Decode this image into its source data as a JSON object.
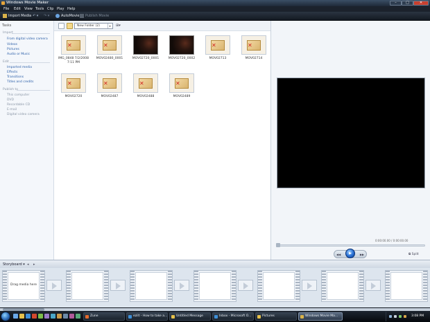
{
  "window": {
    "title": "Windows Movie Maker"
  },
  "menu": [
    "File",
    "Edit",
    "View",
    "Tools",
    "Clip",
    "Play",
    "Help"
  ],
  "toolbar": {
    "import_media": "Import Media",
    "automovie": "AutoMovie",
    "publish_movie": "Publish Movie"
  },
  "tasks": {
    "title": "Tasks",
    "import": {
      "header": "Import",
      "items": [
        "From digital video camera",
        "Videos",
        "Pictures",
        "Audio or Music"
      ]
    },
    "edit": {
      "header": "Edit",
      "items": [
        "Imported media",
        "Effects",
        "Transitions",
        "Titles and credits"
      ]
    },
    "publish": {
      "header": "Publish to",
      "items": [
        "This computer",
        "DVD",
        "Recordable CD",
        "E-mail",
        "Digital video camera"
      ]
    }
  },
  "collection": {
    "folder": "New Folder (2)",
    "items": [
      {
        "caption": "IMG_0848 7/2/2008 7:11 PM",
        "kind": "missing"
      },
      {
        "caption": "MOV02480_0001",
        "kind": "missing"
      },
      {
        "caption": "MOV02720_0001",
        "kind": "dark"
      },
      {
        "caption": "MOV02720_0002",
        "kind": "dark"
      },
      {
        "caption": "MOV02713",
        "kind": "missing"
      },
      {
        "caption": "MOV02714",
        "kind": "missing"
      },
      {
        "caption": "MOV02720",
        "kind": "missing"
      },
      {
        "caption": "MOV02487",
        "kind": "missing"
      },
      {
        "caption": "MOV02488",
        "kind": "missing"
      },
      {
        "caption": "MOV02489",
        "kind": "missing"
      }
    ]
  },
  "preview": {
    "time": "0:00:00.00 / 0:00:00.00",
    "split": "Split"
  },
  "storyboard": {
    "label": "Storyboard",
    "drag_text": "Drag media here"
  },
  "taskbar": {
    "buttons": [
      {
        "label": "Zune",
        "active": false
      },
      {
        "label": "ezilt - How to take a...",
        "active": false
      },
      {
        "label": "Untitled Message",
        "active": false
      },
      {
        "label": "Inbox - Microsoft O...",
        "active": false
      },
      {
        "label": "Pictures",
        "active": false
      },
      {
        "label": "Windows Movie Ma...",
        "active": true
      }
    ],
    "clock": "3:08 PM"
  },
  "colors": {
    "accent": "#2a5ea8",
    "titlebar": "#1e2a38",
    "close": "#c8402f"
  }
}
